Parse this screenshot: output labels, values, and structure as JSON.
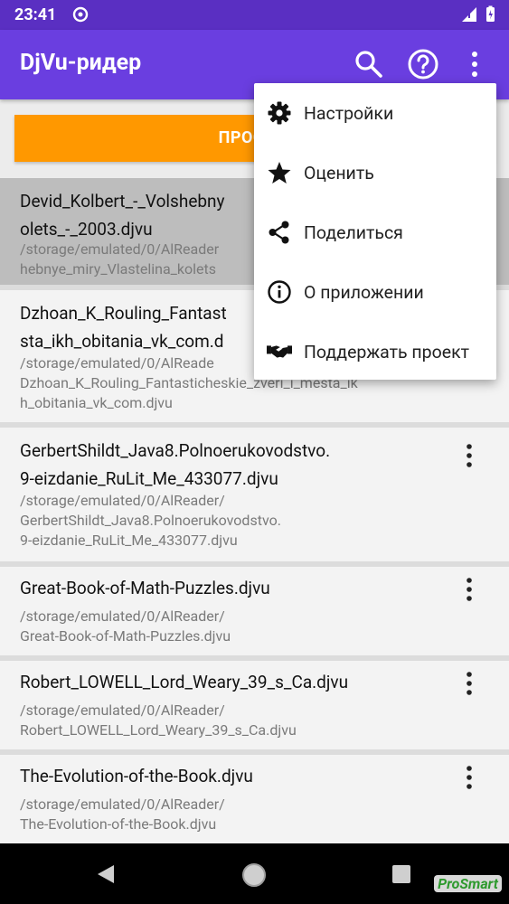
{
  "status_bar": {
    "time": "23:41"
  },
  "app_bar": {
    "title": "DjVu-ридер",
    "icons": [
      "search-icon",
      "help-icon",
      "more-vert-icon"
    ]
  },
  "main": {
    "view_button_label": "ПРОСМО"
  },
  "files": [
    {
      "name_lines": [
        "Devid_Kolbert_-_Volshebny",
        "olets_-_2003.djvu"
      ],
      "path_lines": [
        "/storage/emulated/0/AlReader",
        "hebnye_miry_Vlastelina_kolets"
      ],
      "selected": true
    },
    {
      "name_lines": [
        "Dzhoan_K_Rouling_Fantast",
        "sta_ikh_obitania_vk_com.d"
      ],
      "path_lines": [
        "/storage/emulated/0/AlReade",
        "Dzhoan_K_Rouling_Fantasticheskie_zveri_i_mesta_ik",
        "h_obitania_vk_com.djvu"
      ],
      "selected": false
    },
    {
      "name_lines": [
        "GerbertShildt_Java8.Polnoerukovodstvo.",
        "9-eizdanie_RuLit_Me_433077.djvu"
      ],
      "path_lines": [
        "/storage/emulated/0/AlReader/",
        "GerbertShildt_Java8.Polnoerukovodstvo.",
        "9-eizdanie_RuLit_Me_433077.djvu"
      ],
      "selected": false
    },
    {
      "name_lines": [
        "Great-Book-of-Math-Puzzles.djvu"
      ],
      "path_lines": [
        "/storage/emulated/0/AlReader/",
        "Great-Book-of-Math-Puzzles.djvu"
      ],
      "selected": false
    },
    {
      "name_lines": [
        "Robert_LOWELL_Lord_Weary_39_s_Ca.djvu"
      ],
      "path_lines": [
        "/storage/emulated/0/AlReader/",
        "Robert_LOWELL_Lord_Weary_39_s_Ca.djvu"
      ],
      "selected": false
    },
    {
      "name_lines": [
        "The-Evolution-of-the-Book.djvu"
      ],
      "path_lines": [
        "/storage/emulated/0/AlReader/",
        "The-Evolution-of-the-Book.djvu"
      ],
      "selected": false
    }
  ],
  "popup_menu": {
    "items": [
      {
        "label": "Настройки",
        "icon": "settings-icon"
      },
      {
        "label": "Оценить",
        "icon": "star-icon"
      },
      {
        "label": "Поделиться",
        "icon": "share-icon"
      },
      {
        "label": "О приложении",
        "icon": "info-icon"
      },
      {
        "label": "Поддержать проект",
        "icon": "handshake-icon"
      }
    ]
  },
  "watermark": "ProSmart",
  "colors": {
    "status_bar": "#5a2fc2",
    "app_bar": "#6a3ee0",
    "accent_button": "#ff9800",
    "selected_row": "#bdbdbd"
  }
}
